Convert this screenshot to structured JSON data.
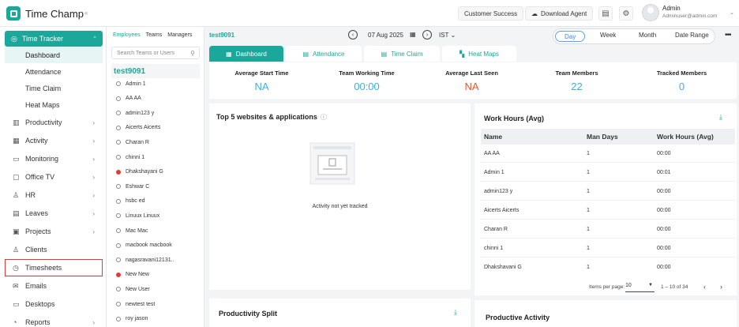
{
  "app": {
    "name": "Time Champ",
    "collapse_glyph": "«"
  },
  "topbar": {
    "customer_success": "Customer Success",
    "download_agent": "Download Agent",
    "user_name": "Admin",
    "user_email": "Adminuser@admin.com"
  },
  "sidebar": {
    "parent": {
      "label": "Time Tracker",
      "icon": "clock-icon"
    },
    "sub_items": [
      {
        "label": "Dashboard",
        "active": true
      },
      {
        "label": "Attendance"
      },
      {
        "label": "Time Claim"
      },
      {
        "label": "Heat Maps"
      }
    ],
    "items": [
      {
        "label": "Productivity",
        "icon": "productivity-icon",
        "has_children": true
      },
      {
        "label": "Activity",
        "icon": "activity-icon",
        "has_children": true
      },
      {
        "label": "Monitoring",
        "icon": "monitor-icon",
        "has_children": true
      },
      {
        "label": "Office TV",
        "icon": "tv-icon",
        "has_children": true
      },
      {
        "label": "HR",
        "icon": "person-icon",
        "has_children": true
      },
      {
        "label": "Leaves",
        "icon": "calendar-icon",
        "has_children": true
      },
      {
        "label": "Projects",
        "icon": "briefcase-icon",
        "has_children": true
      },
      {
        "label": "Clients",
        "icon": "client-icon",
        "has_children": false
      },
      {
        "label": "Timesheets",
        "icon": "timesheet-icon",
        "has_children": false,
        "highlighted": true
      },
      {
        "label": "Emails",
        "icon": "mail-icon",
        "has_children": false
      },
      {
        "label": "Desktops",
        "icon": "desktop-icon",
        "has_children": false
      },
      {
        "label": "Reports",
        "icon": "reports-icon",
        "has_children": true
      }
    ]
  },
  "employees": {
    "tabs": [
      "Employees",
      "Teams",
      "Managers"
    ],
    "search_placeholder": "Search Teams or Users",
    "group": "test9091",
    "list": [
      {
        "name": "Admin 1",
        "flag": false
      },
      {
        "name": "AA AA",
        "flag": false
      },
      {
        "name": "admin123 y",
        "flag": false
      },
      {
        "name": "Aicerts Aicerts",
        "flag": false
      },
      {
        "name": "Charan R",
        "flag": false
      },
      {
        "name": "chinni 1",
        "flag": false
      },
      {
        "name": "Dhakshayani G",
        "flag": true
      },
      {
        "name": "Eshwar C",
        "flag": false
      },
      {
        "name": "hsbc ed",
        "flag": false
      },
      {
        "name": "Linuux Linuux",
        "flag": false
      },
      {
        "name": "Mac Mac",
        "flag": false
      },
      {
        "name": "macbook macbook",
        "flag": false
      },
      {
        "name": "nagasravani12131..",
        "flag": false
      },
      {
        "name": "New New",
        "flag": true
      },
      {
        "name": "New User",
        "flag": false
      },
      {
        "name": "newtest test",
        "flag": false
      },
      {
        "name": "roy jason",
        "flag": false
      }
    ]
  },
  "main": {
    "title": "test9091",
    "date": "07 Aug 2025",
    "timezone": "IST",
    "ranges": [
      "Day",
      "Week",
      "Month",
      "Date Range"
    ],
    "active_range": "Day",
    "subtabs": [
      {
        "label": "Dashboard",
        "active": true
      },
      {
        "label": "Attendance"
      },
      {
        "label": "Time Claim"
      },
      {
        "label": "Heat Maps"
      }
    ],
    "stats": [
      {
        "label": "Average Start Time",
        "value": "NA",
        "color": "#3ab0e2"
      },
      {
        "label": "Team Working Time",
        "value": "00:00",
        "color": "#3ab0e2"
      },
      {
        "label": "Average Last Seen",
        "value": "NA",
        "color": "#e8552b"
      },
      {
        "label": "Team Members",
        "value": "22",
        "color": "#3ab0e2"
      },
      {
        "label": "Tracked Members",
        "value": "0",
        "color": "#3ab0e2"
      }
    ],
    "top_websites": {
      "title": "Top 5 websites & applications",
      "empty": "Activity not yet tracked"
    },
    "work_hours": {
      "title": "Work Hours (Avg)",
      "columns": [
        "Name",
        "Man Days",
        "Work Hours (Avg)"
      ],
      "rows": [
        [
          "AA AA",
          "1",
          "00:00"
        ],
        [
          "Admin 1",
          "1",
          "00:01"
        ],
        [
          "admin123 y",
          "1",
          "00:00"
        ],
        [
          "Aicerts Aicerts",
          "1",
          "00:00"
        ],
        [
          "Charan R",
          "1",
          "00:00"
        ],
        [
          "chinni 1",
          "1",
          "00:00"
        ],
        [
          "Dhakshayani G",
          "1",
          "00:00"
        ]
      ],
      "items_per_page_label": "Items per page:",
      "items_per_page": "10",
      "range": "1 – 10 of 34"
    },
    "productivity_split": {
      "title": "Productivity Split"
    },
    "productive_activity": {
      "title": "Productive Activity"
    }
  },
  "colors": {
    "brand": "#1ba89b",
    "highlight_border": "#e53935",
    "stat_blue": "#3ab0e2",
    "stat_orange": "#e8552b"
  }
}
